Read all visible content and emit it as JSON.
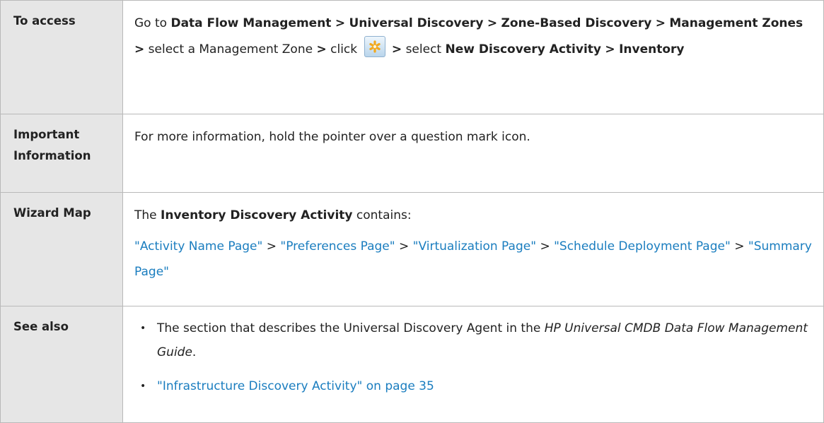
{
  "rows": {
    "access": {
      "label": "To access",
      "t1": "Go to",
      "b1": "Data Flow Management",
      "s1": ">",
      "b2": "Universal Discovery",
      "s2": ">",
      "b3": "Zone-Based Discovery",
      "s3": ">",
      "b4": "Management Zones",
      "s4": ">",
      "t2": "select a Management Zone",
      "s5": ">",
      "t3": "click",
      "icon": "new-asterisk-icon",
      "s6": ">",
      "t4": "select",
      "b5": "New Discovery Activity",
      "s7": ">",
      "b6": "Inventory"
    },
    "important": {
      "label": "Important Information",
      "text": "For more information, hold the pointer over a question mark icon."
    },
    "wizard": {
      "label": "Wizard Map",
      "t1": "The",
      "b1": "Inventory Discovery Activity",
      "t2": "contains:",
      "links": [
        "\"Activity Name Page\"",
        "\"Preferences Page\"",
        "\"Virtualization Page\"",
        "\"Schedule Deployment Page\"",
        "\"Summary Page\""
      ],
      "sep": ">"
    },
    "see_also": {
      "label": "See also",
      "item1_pre": "The section that describes the Universal Discovery Agent in the",
      "item1_italic": "HP Universal CMDB Data Flow Management Guide",
      "item1_post": ".",
      "item2_link": "\"Infrastructure Discovery Activity\" on page 35"
    }
  },
  "colors": {
    "link": "#1a7dbf",
    "label_bg": "#e6e6e6",
    "border": "#b9b9b9"
  }
}
